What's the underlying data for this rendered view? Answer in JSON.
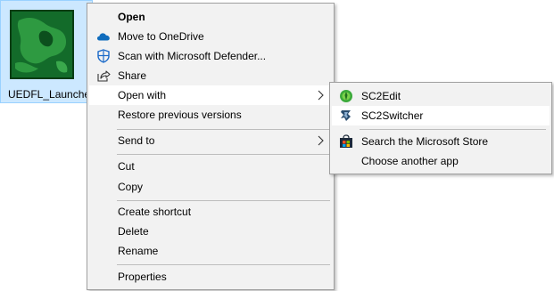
{
  "desktop_file": {
    "label": "UEDFL_Launcher",
    "icon": "map-thumbnail-icon"
  },
  "context_menu": {
    "items": [
      {
        "label": "Open",
        "bold": true
      },
      {
        "label": "Move to OneDrive",
        "icon": "onedrive-cloud-icon"
      },
      {
        "label": "Scan with Microsoft Defender...",
        "icon": "defender-shield-icon"
      },
      {
        "label": "Share",
        "icon": "share-icon"
      },
      {
        "label": "Open with",
        "submenu": true
      },
      {
        "label": "Restore previous versions"
      },
      {
        "label": "Send to",
        "submenu": true
      },
      {
        "label": "Cut"
      },
      {
        "label": "Copy"
      },
      {
        "label": "Create shortcut"
      },
      {
        "label": "Delete"
      },
      {
        "label": "Rename"
      },
      {
        "label": "Properties"
      }
    ]
  },
  "open_with_submenu": {
    "items": [
      {
        "label": "SC2Edit",
        "icon": "sc2edit-icon"
      },
      {
        "label": "SC2Switcher",
        "icon": "sc2switcher-icon"
      },
      {
        "label": "Search the Microsoft Store",
        "icon": "microsoft-store-icon"
      },
      {
        "label": "Choose another app"
      }
    ]
  },
  "colors": {
    "menu_bg": "#f2f2f2",
    "menu_border": "#a0a0a0",
    "hover_bg": "#ffffff",
    "selection_bg": "#cce8ff",
    "onedrive_blue": "#0f6cbd",
    "defender_blue": "#1b6ac9",
    "sc2_green": "#3aa93a"
  }
}
